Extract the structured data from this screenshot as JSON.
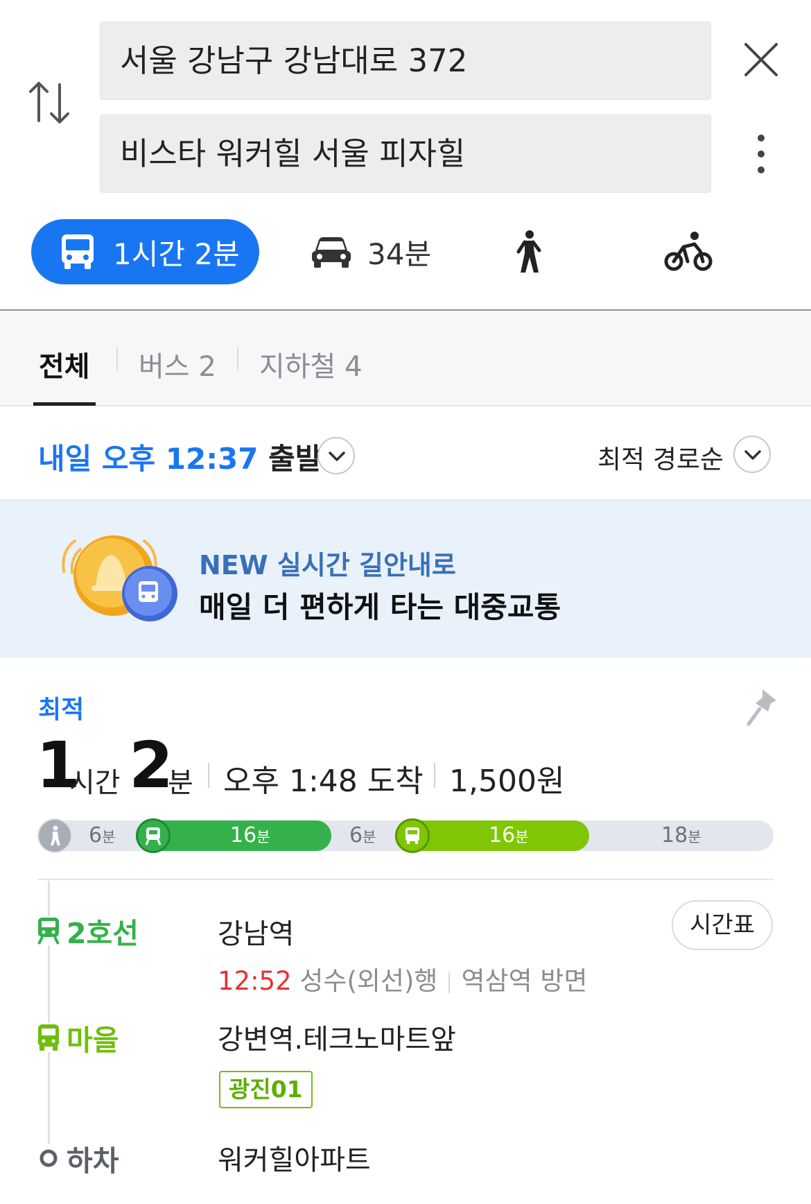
{
  "search": {
    "origin": "서울 강남구 강남대로 372",
    "destination": "비스타 워커힐 서울 피자힐"
  },
  "modes": {
    "transit": "1시간 2분",
    "car": "34분"
  },
  "tabs": {
    "all": "전체",
    "bus": "버스 2",
    "subway": "지하철 4"
  },
  "departure": {
    "time": "내일 오후 12:37",
    "suffix": " 출발",
    "sort": "최적 경로순"
  },
  "banner": {
    "line1": "NEW 실시간 길안내로",
    "line2": "매일 더 편하게 타는 대중교통"
  },
  "route": {
    "badge": "최적",
    "hours": "1",
    "hours_unit": "시간",
    "minutes": "2",
    "minutes_unit": "분",
    "arrival": "오후 1:48 도착",
    "fare": "1,500원",
    "segments": [
      {
        "type": "walk",
        "minutes": "6",
        "unit": "분"
      },
      {
        "type": "subway",
        "minutes": "16",
        "unit": "분"
      },
      {
        "type": "walk",
        "minutes": "6",
        "unit": "분"
      },
      {
        "type": "bus",
        "minutes": "16",
        "unit": "분"
      },
      {
        "type": "walk",
        "minutes": "18",
        "unit": "분"
      }
    ],
    "steps": {
      "subway_line": "2호선",
      "subway_stop": "강남역",
      "subway_time": "12:52",
      "subway_dest": " 성수(외선)행",
      "subway_direction": "역삼역 방면",
      "timetable": "시간표",
      "bus_line": "마을",
      "bus_stop": "강변역.테크노마트앞",
      "bus_route": "광진01",
      "alight_label": "하차",
      "alight_stop": "워커힐아파트"
    }
  },
  "colors": {
    "accent": "#1976f2",
    "subway_green": "#34b14a",
    "bus_green": "#80c605",
    "red": "#e5322d"
  }
}
